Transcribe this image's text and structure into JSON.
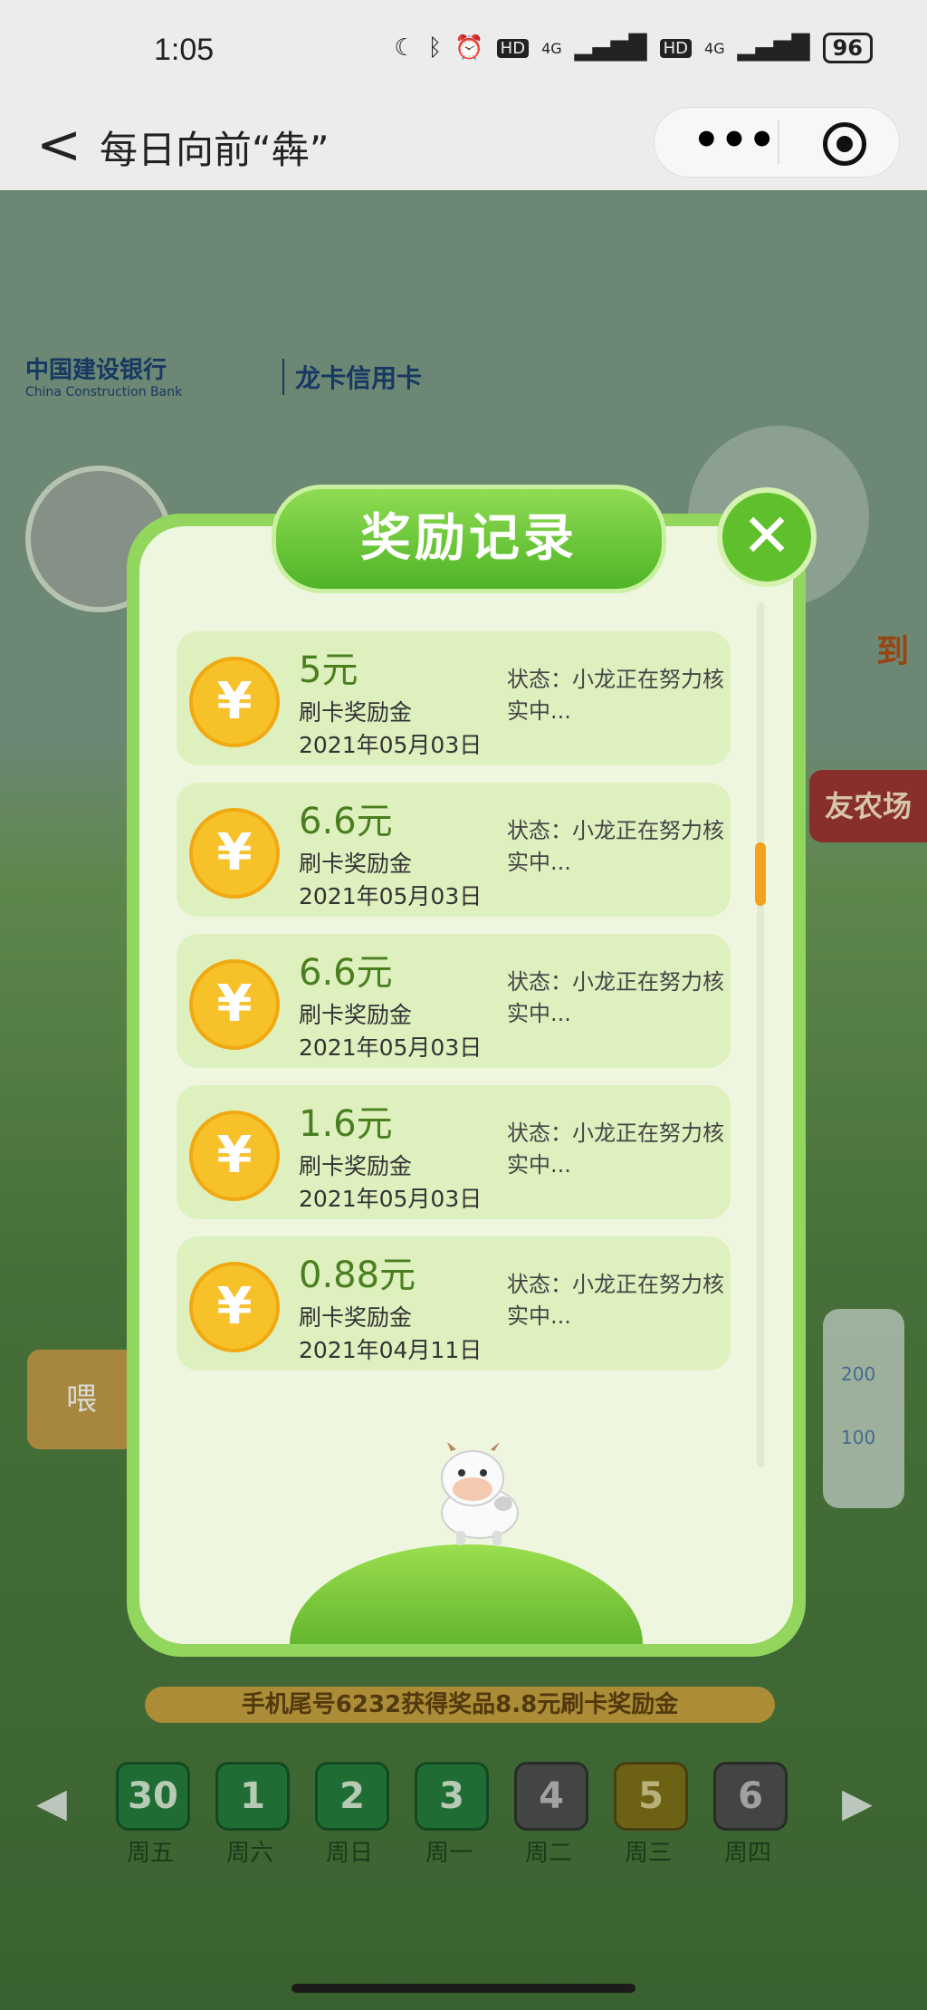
{
  "status_bar": {
    "time": "1:05",
    "network_1": "4G",
    "network_2": "4G",
    "hd_1": "HD",
    "hd_2": "HD",
    "battery": "96"
  },
  "nav": {
    "title": "每日向前“犇”",
    "back": "<",
    "menu_icon": "more-dots-icon",
    "close_mini_icon": "target-icon"
  },
  "background": {
    "bank_name": "中国建设银行",
    "bank_name_en": "China Construction Bank",
    "card_name": "龙卡信用卡",
    "side_sign": "到",
    "farm_button": "友农场",
    "feed_button": "喂",
    "milk_200": "200",
    "milk_100": "100"
  },
  "modal": {
    "title": "奖励记录",
    "close_label": "✕",
    "coin_symbol": "¥",
    "records": [
      {
        "amount": "5元",
        "type": "刷卡奖励金",
        "date": "2021年05月03日",
        "status": "状态：小龙正在努力核实中..."
      },
      {
        "amount": "6.6元",
        "type": "刷卡奖励金",
        "date": "2021年05月03日",
        "status": "状态：小龙正在努力核实中..."
      },
      {
        "amount": "6.6元",
        "type": "刷卡奖励金",
        "date": "2021年05月03日",
        "status": "状态：小龙正在努力核实中..."
      },
      {
        "amount": "1.6元",
        "type": "刷卡奖励金",
        "date": "2021年05月03日",
        "status": "状态：小龙正在努力核实中..."
      },
      {
        "amount": "0.88元",
        "type": "刷卡奖励金",
        "date": "2021年04月11日",
        "status": "状态：小龙正在努力核实中..."
      }
    ]
  },
  "winner_notice": "手机尾号6232获得奖品8.8元刷卡奖励金",
  "days": [
    {
      "num": "30",
      "weekday": "周五",
      "state": "done"
    },
    {
      "num": "1",
      "weekday": "周六",
      "state": "done"
    },
    {
      "num": "2",
      "weekday": "周日",
      "state": "done"
    },
    {
      "num": "3",
      "weekday": "周一",
      "state": "done"
    },
    {
      "num": "4",
      "weekday": "周二",
      "state": "missed"
    },
    {
      "num": "5",
      "weekday": "周三",
      "state": "today"
    },
    {
      "num": "6",
      "weekday": "周四",
      "state": "missed"
    }
  ],
  "colors": {
    "accent_green": "#5fc02c",
    "record_bg": "#dff0bf",
    "coin": "#f7c12a",
    "scroll_thumb": "#f2a21c"
  }
}
